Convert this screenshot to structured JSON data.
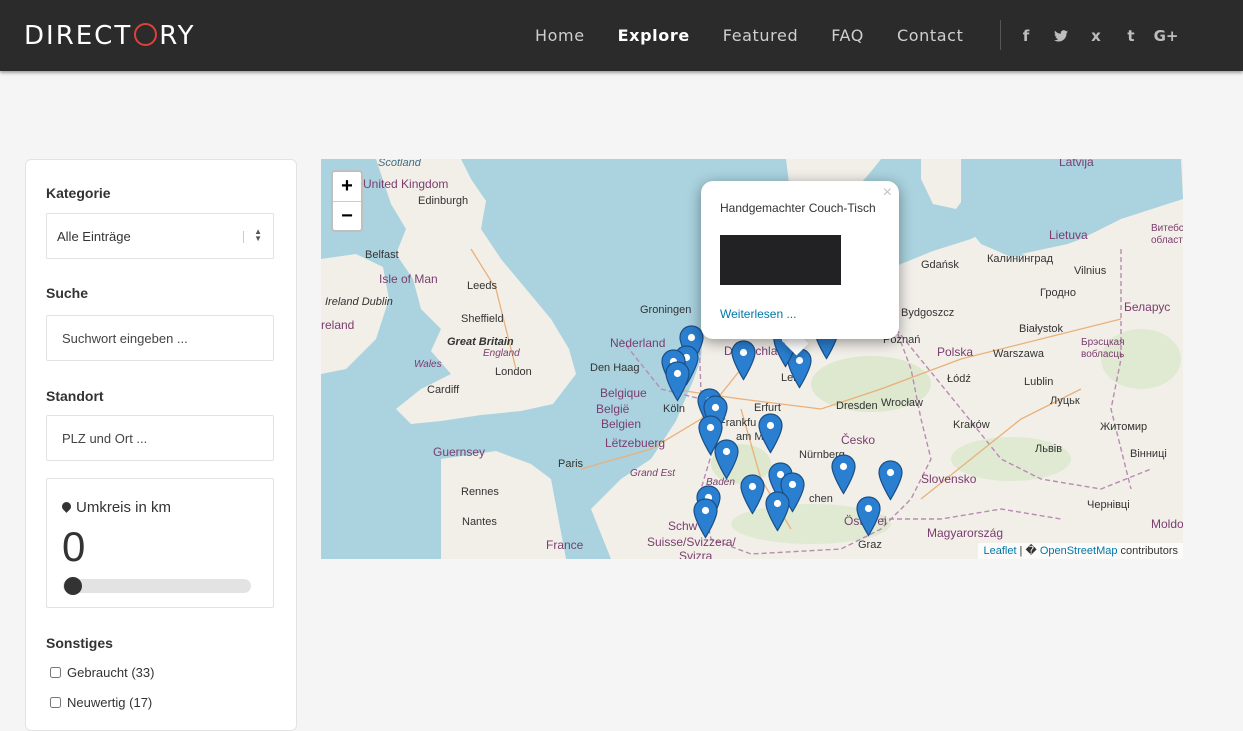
{
  "brand": {
    "logo_left": "DIRECT",
    "logo_right": "RY"
  },
  "nav": {
    "items": [
      {
        "label": "Home",
        "active": false
      },
      {
        "label": "Explore",
        "active": true
      },
      {
        "label": "Featured",
        "active": false
      },
      {
        "label": "FAQ",
        "active": false
      },
      {
        "label": "Contact",
        "active": false
      }
    ],
    "social": [
      {
        "icon": "facebook-icon",
        "glyph": "f"
      },
      {
        "icon": "twitter-icon",
        "glyph": "t"
      },
      {
        "icon": "xing-icon",
        "glyph": "x"
      },
      {
        "icon": "tumblr-icon",
        "glyph": "t"
      },
      {
        "icon": "google-plus-icon",
        "glyph": "G+"
      }
    ]
  },
  "filters": {
    "category_label": "Kategorie",
    "category_value": "Alle Einträge",
    "search_label": "Suche",
    "search_placeholder": "Suchwort eingeben ...",
    "location_label": "Standort",
    "location_placeholder": "PLZ und Ort ...",
    "radius_label": "Umkreis in km",
    "radius_value": "0",
    "other_label": "Sonstiges",
    "checkboxes": [
      {
        "label": "Gebraucht (33)",
        "checked": false
      },
      {
        "label": "Neuwertig (17)",
        "checked": false
      }
    ]
  },
  "map": {
    "zoom_in": "+",
    "zoom_out": "−",
    "popup": {
      "title": "Handgemachter Couch-Tisch",
      "link": "Weiterlesen ...",
      "close": "×"
    },
    "attribution": {
      "leaflet": "Leaflet",
      "sep": " | � ",
      "osm": "OpenStreetMap",
      "suffix": " contributors"
    },
    "places": {
      "scotland": "Scotland",
      "edinburgh": "Edinburgh",
      "uk": "United Kingdom",
      "belfast": "Belfast",
      "isle_of_man": "Isle of Man",
      "leeds": "Leeds",
      "ireland_dublin": "Ireland Dublin",
      "ireland": "reland",
      "sheffield": "Sheffield",
      "great_britain": "Great Britain",
      "england": "England",
      "wales": "Wales",
      "london": "London",
      "cardiff": "Cardiff",
      "guernsey": "Guernsey",
      "rennes": "Rennes",
      "paris": "Paris",
      "nantes": "Nantes",
      "france": "France",
      "grand_est": "Grand Est",
      "groningen": "Groningen",
      "nederland": "Nederland",
      "den_haag": "Den Haag",
      "belgique": "Belgique",
      "belgie": "België",
      "belgien": "Belgien",
      "letzebuerg": "Lëtzebuerg",
      "koln": "Köln",
      "deutschland": "Deutschla",
      "erfurt": "Erfurt",
      "frankfurt": "Frankfu",
      "am_main": "am Main",
      "leipzig": "Lei",
      "dresden": "Dresden",
      "nurnberg": "Nürnberg",
      "baden": "Baden",
      "chen": "chen",
      "osterreich": "Österrei",
      "graz": "Graz",
      "schweiz": "Schw",
      "suisse": "Suisse/Svizzera/",
      "svizra": "Svizra",
      "cesko": "Česko",
      "wroclaw": "Wrocław",
      "polska": "Polska",
      "warszawa": "Warszawa",
      "poznan": "Poznań",
      "lodz": "Łódź",
      "bydgoszcz": "Bydgoszcz",
      "gdansk": "Gdańsk",
      "krakow": "Kraków",
      "lublin": "Lublin",
      "bialystok": "Białystok",
      "slovensko": "Slovensko",
      "magyarorszag": "Magyarország",
      "latvija": "Latvija",
      "lietuva": "Lietuva",
      "vilnius": "Vilnius",
      "kaliningrad": "Калининград",
      "grodno": "Гродно",
      "belarus": "Беларус",
      "brest_obl": "Брэсцкая вобласць",
      "vitebsk": "Витебская области",
      "lutsk": "Луцьк",
      "zhytomyr": "Житомир",
      "lviv": "Львів",
      "vinnytsia": "Вінниці",
      "chernivtsi": "Чернівці",
      "moldova": "Moldov"
    }
  }
}
